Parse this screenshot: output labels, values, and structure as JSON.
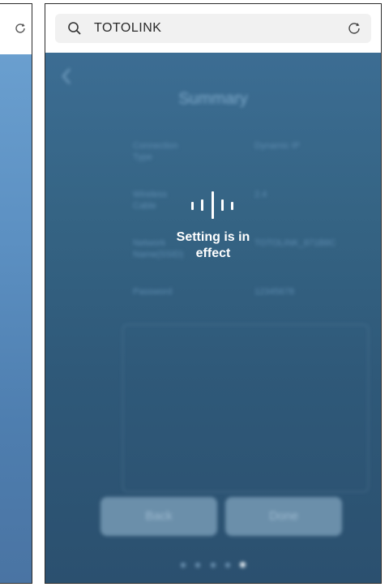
{
  "browser": {
    "url_text": "TOTOLINK"
  },
  "summary": {
    "title": "Summary",
    "rows": [
      {
        "label": "Connection\nType",
        "value": "Dynamic IP"
      },
      {
        "label": "Wireless\nCable",
        "value": "2.4"
      },
      {
        "label": "Network\nName(SSID)",
        "value": "TOTOLINK_871B8C"
      },
      {
        "label": "Password",
        "value": "12345678"
      }
    ]
  },
  "buttons": {
    "back": "Back",
    "done": "Done"
  },
  "pager": {
    "count": 5,
    "active_index": 4
  },
  "loading": {
    "message": "Setting is in\neffect"
  }
}
